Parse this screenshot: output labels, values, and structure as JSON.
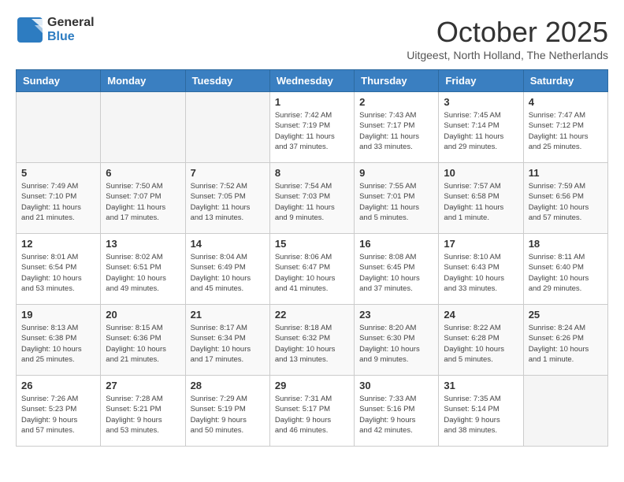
{
  "header": {
    "logo_line1": "General",
    "logo_line2": "Blue",
    "month": "October 2025",
    "location": "Uitgeest, North Holland, The Netherlands"
  },
  "days_of_week": [
    "Sunday",
    "Monday",
    "Tuesday",
    "Wednesday",
    "Thursday",
    "Friday",
    "Saturday"
  ],
  "weeks": [
    [
      {
        "num": "",
        "info": ""
      },
      {
        "num": "",
        "info": ""
      },
      {
        "num": "",
        "info": ""
      },
      {
        "num": "1",
        "info": "Sunrise: 7:42 AM\nSunset: 7:19 PM\nDaylight: 11 hours\nand 37 minutes."
      },
      {
        "num": "2",
        "info": "Sunrise: 7:43 AM\nSunset: 7:17 PM\nDaylight: 11 hours\nand 33 minutes."
      },
      {
        "num": "3",
        "info": "Sunrise: 7:45 AM\nSunset: 7:14 PM\nDaylight: 11 hours\nand 29 minutes."
      },
      {
        "num": "4",
        "info": "Sunrise: 7:47 AM\nSunset: 7:12 PM\nDaylight: 11 hours\nand 25 minutes."
      }
    ],
    [
      {
        "num": "5",
        "info": "Sunrise: 7:49 AM\nSunset: 7:10 PM\nDaylight: 11 hours\nand 21 minutes."
      },
      {
        "num": "6",
        "info": "Sunrise: 7:50 AM\nSunset: 7:07 PM\nDaylight: 11 hours\nand 17 minutes."
      },
      {
        "num": "7",
        "info": "Sunrise: 7:52 AM\nSunset: 7:05 PM\nDaylight: 11 hours\nand 13 minutes."
      },
      {
        "num": "8",
        "info": "Sunrise: 7:54 AM\nSunset: 7:03 PM\nDaylight: 11 hours\nand 9 minutes."
      },
      {
        "num": "9",
        "info": "Sunrise: 7:55 AM\nSunset: 7:01 PM\nDaylight: 11 hours\nand 5 minutes."
      },
      {
        "num": "10",
        "info": "Sunrise: 7:57 AM\nSunset: 6:58 PM\nDaylight: 11 hours\nand 1 minute."
      },
      {
        "num": "11",
        "info": "Sunrise: 7:59 AM\nSunset: 6:56 PM\nDaylight: 10 hours\nand 57 minutes."
      }
    ],
    [
      {
        "num": "12",
        "info": "Sunrise: 8:01 AM\nSunset: 6:54 PM\nDaylight: 10 hours\nand 53 minutes."
      },
      {
        "num": "13",
        "info": "Sunrise: 8:02 AM\nSunset: 6:51 PM\nDaylight: 10 hours\nand 49 minutes."
      },
      {
        "num": "14",
        "info": "Sunrise: 8:04 AM\nSunset: 6:49 PM\nDaylight: 10 hours\nand 45 minutes."
      },
      {
        "num": "15",
        "info": "Sunrise: 8:06 AM\nSunset: 6:47 PM\nDaylight: 10 hours\nand 41 minutes."
      },
      {
        "num": "16",
        "info": "Sunrise: 8:08 AM\nSunset: 6:45 PM\nDaylight: 10 hours\nand 37 minutes."
      },
      {
        "num": "17",
        "info": "Sunrise: 8:10 AM\nSunset: 6:43 PM\nDaylight: 10 hours\nand 33 minutes."
      },
      {
        "num": "18",
        "info": "Sunrise: 8:11 AM\nSunset: 6:40 PM\nDaylight: 10 hours\nand 29 minutes."
      }
    ],
    [
      {
        "num": "19",
        "info": "Sunrise: 8:13 AM\nSunset: 6:38 PM\nDaylight: 10 hours\nand 25 minutes."
      },
      {
        "num": "20",
        "info": "Sunrise: 8:15 AM\nSunset: 6:36 PM\nDaylight: 10 hours\nand 21 minutes."
      },
      {
        "num": "21",
        "info": "Sunrise: 8:17 AM\nSunset: 6:34 PM\nDaylight: 10 hours\nand 17 minutes."
      },
      {
        "num": "22",
        "info": "Sunrise: 8:18 AM\nSunset: 6:32 PM\nDaylight: 10 hours\nand 13 minutes."
      },
      {
        "num": "23",
        "info": "Sunrise: 8:20 AM\nSunset: 6:30 PM\nDaylight: 10 hours\nand 9 minutes."
      },
      {
        "num": "24",
        "info": "Sunrise: 8:22 AM\nSunset: 6:28 PM\nDaylight: 10 hours\nand 5 minutes."
      },
      {
        "num": "25",
        "info": "Sunrise: 8:24 AM\nSunset: 6:26 PM\nDaylight: 10 hours\nand 1 minute."
      }
    ],
    [
      {
        "num": "26",
        "info": "Sunrise: 7:26 AM\nSunset: 5:23 PM\nDaylight: 9 hours\nand 57 minutes."
      },
      {
        "num": "27",
        "info": "Sunrise: 7:28 AM\nSunset: 5:21 PM\nDaylight: 9 hours\nand 53 minutes."
      },
      {
        "num": "28",
        "info": "Sunrise: 7:29 AM\nSunset: 5:19 PM\nDaylight: 9 hours\nand 50 minutes."
      },
      {
        "num": "29",
        "info": "Sunrise: 7:31 AM\nSunset: 5:17 PM\nDaylight: 9 hours\nand 46 minutes."
      },
      {
        "num": "30",
        "info": "Sunrise: 7:33 AM\nSunset: 5:16 PM\nDaylight: 9 hours\nand 42 minutes."
      },
      {
        "num": "31",
        "info": "Sunrise: 7:35 AM\nSunset: 5:14 PM\nDaylight: 9 hours\nand 38 minutes."
      },
      {
        "num": "",
        "info": ""
      }
    ]
  ]
}
